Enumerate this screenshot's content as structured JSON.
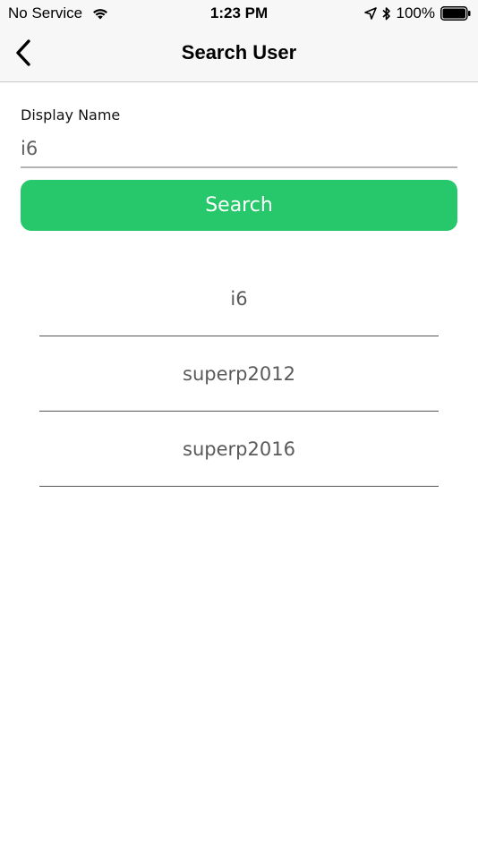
{
  "status_bar": {
    "carrier": "No Service",
    "time": "1:23 PM",
    "battery": "100%"
  },
  "nav": {
    "title": "Search User",
    "back_icon": "chevron-left-icon"
  },
  "form": {
    "label": "Display Name",
    "value": "i6",
    "button_label": "Search"
  },
  "colors": {
    "accent": "#26c86b",
    "nav_background": "#f7f7f7"
  },
  "results": [
    {
      "name": "i6"
    },
    {
      "name": "superp2012"
    },
    {
      "name": "superp2016"
    }
  ]
}
